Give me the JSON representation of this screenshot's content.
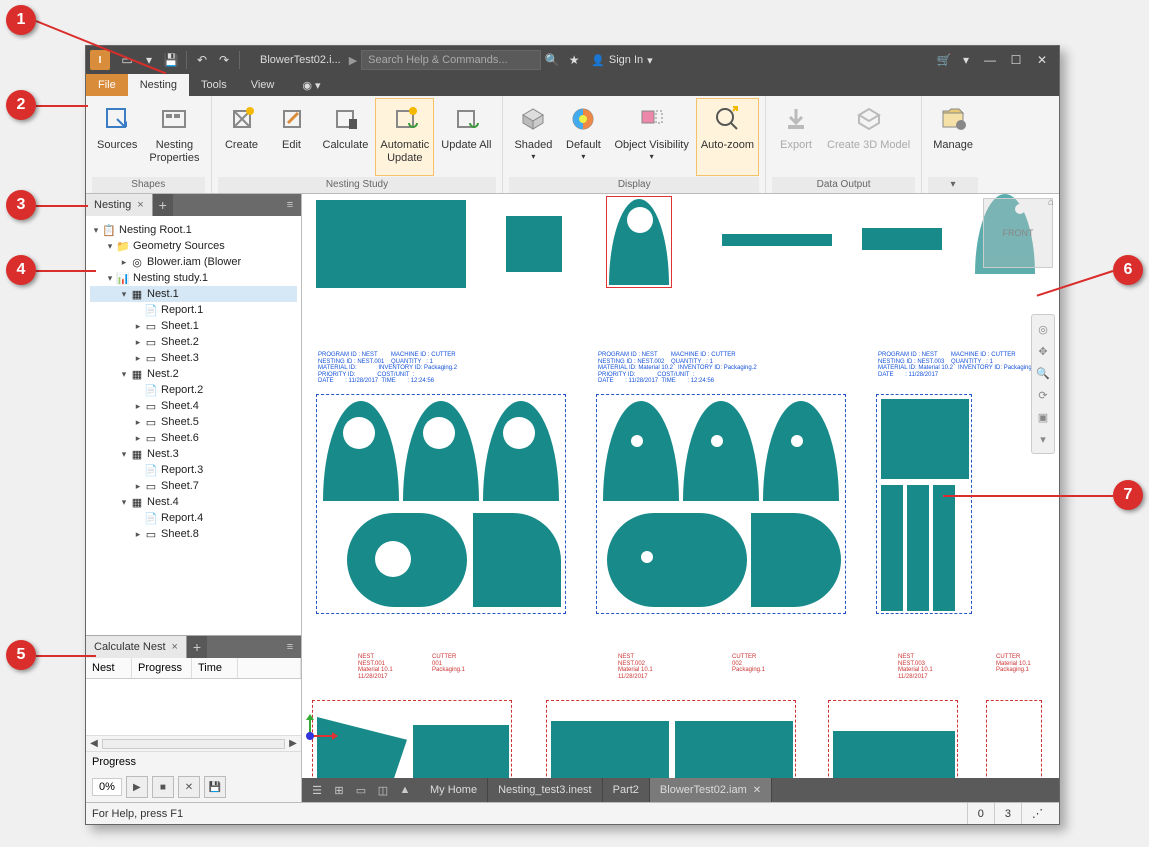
{
  "titlebar": {
    "doc_title": "BlowerTest02.i...",
    "search_placeholder": "Search Help & Commands...",
    "signin": "Sign In"
  },
  "ribbon_tabs": {
    "file": "File",
    "nesting": "Nesting",
    "tools": "Tools",
    "view": "View"
  },
  "ribbon": {
    "shapes": {
      "label": "Shapes",
      "sources": "Sources",
      "properties": "Nesting\nProperties"
    },
    "study": {
      "label": "Nesting Study",
      "create": "Create",
      "edit": "Edit",
      "calculate": "Calculate",
      "auto": "Automatic\nUpdate",
      "update_all": "Update All"
    },
    "display": {
      "label": "Display",
      "shaded": "Shaded",
      "default": "Default",
      "obj_vis": "Object Visibility",
      "autozoom": "Auto-zoom"
    },
    "output": {
      "label": "Data Output",
      "export": "Export",
      "create3d": "Create 3D Model"
    },
    "manage": {
      "label": "Manage"
    }
  },
  "browser_tab": "Nesting",
  "tree": {
    "root": "Nesting Root.1",
    "geom": "Geometry Sources",
    "blower": "Blower.iam (Blower",
    "study": "Nesting study.1",
    "nests": [
      {
        "name": "Nest.1",
        "report": "Report.1",
        "sheets": [
          "Sheet.1",
          "Sheet.2",
          "Sheet.3"
        ]
      },
      {
        "name": "Nest.2",
        "report": "Report.2",
        "sheets": [
          "Sheet.4",
          "Sheet.5",
          "Sheet.6"
        ]
      },
      {
        "name": "Nest.3",
        "report": "Report.3",
        "sheets": [
          "Sheet.7"
        ]
      },
      {
        "name": "Nest.4",
        "report": "Report.4",
        "sheets": [
          "Sheet.8"
        ]
      }
    ]
  },
  "calc_tab": "Calculate Nest",
  "calc_cols": {
    "nest": "Nest",
    "progress": "Progress",
    "time": "Time"
  },
  "calc_progress_label": "Progress",
  "calc_pct": "0%",
  "viewcube": "FRONT",
  "doc_tabs": {
    "home": "My Home",
    "t1": "Nesting_test3.inest",
    "t2": "Part2",
    "t3": "BlowerTest02.iam"
  },
  "status": {
    "help": "For Help, press F1",
    "n1": "0",
    "n2": "3"
  },
  "callouts": {
    "c1": "1",
    "c2": "2",
    "c3": "3",
    "c4": "4",
    "c5": "5",
    "c6": "6",
    "c7": "7"
  }
}
